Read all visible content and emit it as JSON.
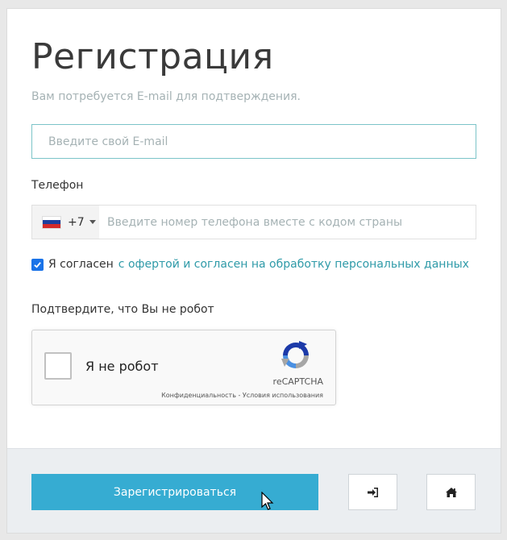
{
  "title": "Регистрация",
  "subtitle": "Вам потребуется E-mail для подтверждения.",
  "email": {
    "placeholder": "Введите свой E-mail",
    "value": ""
  },
  "phone": {
    "label": "Телефон",
    "country_code": "+7",
    "country_flag": "russia-flag-icon",
    "placeholder": "Введите номер телефона вместе с кодом страны",
    "value": ""
  },
  "agreement": {
    "checked": true,
    "text": "Я согласен",
    "link_text": "с офертой и согласен на обработку персональных данных"
  },
  "robot_check": {
    "label": "Подтвердите, что Вы не робот",
    "checkbox_label": "Я не робот",
    "brand": "reCAPTCHA",
    "terms": "Конфиденциальность - Условия использования"
  },
  "footer": {
    "register_label": "Зарегистрироваться",
    "login_icon": "sign-in-icon",
    "home_icon": "home-icon"
  },
  "colors": {
    "accent": "#36acd2",
    "link": "#2e9aa8",
    "input_focus_border": "#7cc4c8",
    "muted_text": "#a5b2b4",
    "checkbox": "#1a73e8"
  }
}
